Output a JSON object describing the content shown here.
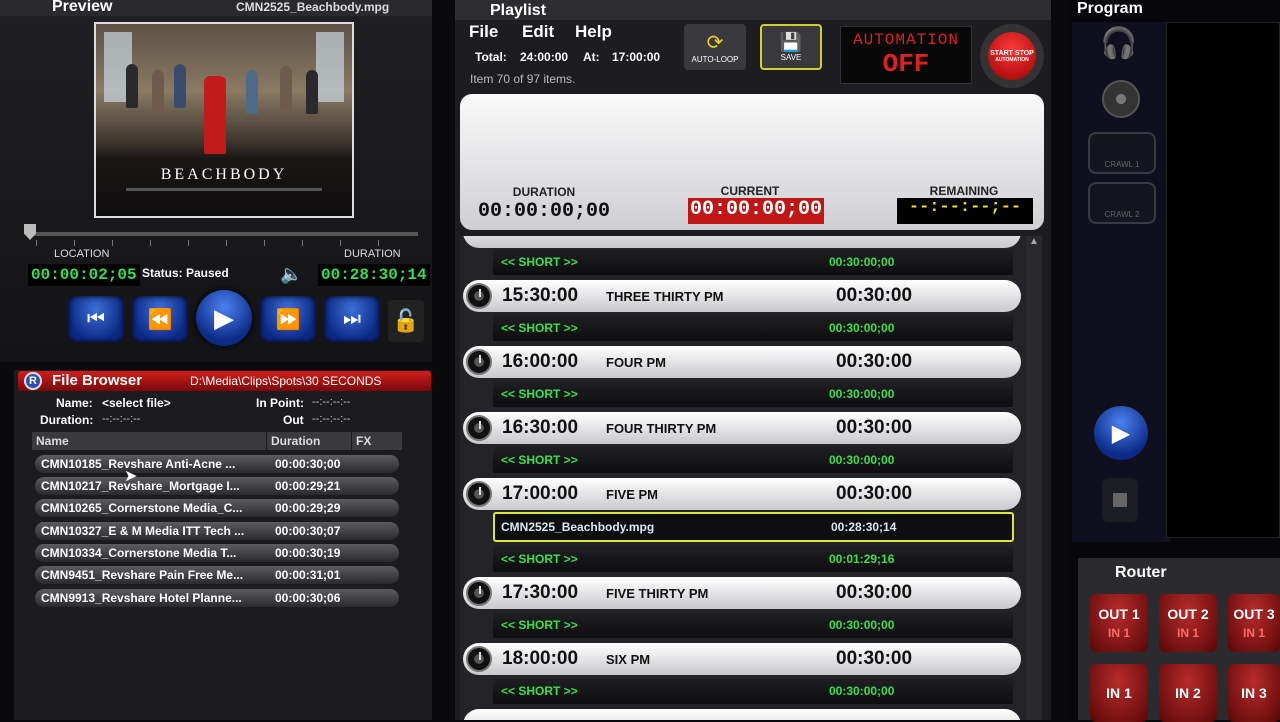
{
  "preview": {
    "title": "Preview",
    "file": "CMN2525_Beachbody.mpg",
    "video_brand": "BEACHBODY",
    "location_label": "LOCATION",
    "duration_label": "DURATION",
    "location": "00:00:02;05",
    "status": "Status: Paused",
    "duration": "00:28:30;14"
  },
  "file_browser": {
    "title": "File Browser",
    "path": "D:\\Media\\Clips\\Spots\\30 SECONDS",
    "name_label": "Name:",
    "name_value": "<select file>",
    "duration_label": "Duration:",
    "duration_value": "--:--:--:--",
    "in_label": "In Point:",
    "in_value": "--:--:--:--",
    "out_label": "Out",
    "out_value": "--:--:--:--",
    "columns": [
      "Name",
      "Duration",
      "FX"
    ],
    "files": [
      {
        "name": "CMN10185_Revshare Anti-Acne ...",
        "duration": "00:00:30;00"
      },
      {
        "name": "CMN10217_Revshare_Mortgage I...",
        "duration": "00:00:29;21"
      },
      {
        "name": "CMN10265_Cornerstone Media_C...",
        "duration": "00:00:29;29"
      },
      {
        "name": "CMN10327_E & M Media ITT Tech ...",
        "duration": "00:00:30;07"
      },
      {
        "name": "CMN10334_Cornerstone Media T...",
        "duration": "00:00:30;19"
      },
      {
        "name": "CMN9451_Revshare Pain Free Me...",
        "duration": "00:00:31;01"
      },
      {
        "name": "CMN9913_Revshare Hotel Planne...",
        "duration": "00:00:30;06"
      }
    ]
  },
  "playlist": {
    "title": "Playlist",
    "menu": [
      "File",
      "Edit",
      "Help"
    ],
    "total_label": "Total:",
    "total": "24:00:00",
    "at_label": "At:",
    "at": "17:00:00",
    "item_info": "Item 70 of 97 items.",
    "autoloop": "AUTO-LOOP",
    "save": "SAVE",
    "automation_label": "AUTOMATION",
    "automation_state": "OFF",
    "start_stop": "START STOP",
    "automation_small": "AUTOMATION",
    "duration_label": "DURATION",
    "duration": "00:00:00;00",
    "current_label": "CURRENT",
    "current": "00:00:00;00",
    "remaining_label": "REMAINING",
    "remaining": "--:--:--;--",
    "short_label": "<< SHORT >>",
    "blocks": [
      {
        "time": "15:30:00",
        "name": "THREE THIRTY PM",
        "dur": "00:30:00",
        "short": "00:30:00;00"
      },
      {
        "time": "16:00:00",
        "name": "FOUR PM",
        "dur": "00:30:00",
        "short": "00:30:00;00"
      },
      {
        "time": "16:30:00",
        "name": "FOUR THIRTY PM",
        "dur": "00:30:00",
        "short": "00:30:00;00"
      },
      {
        "time": "17:00:00",
        "name": "FIVE PM",
        "dur": "00:30:00",
        "clip": "CMN2525_Beachbody.mpg",
        "clip_dur": "00:28:30;14",
        "short": "00:01:29;16"
      },
      {
        "time": "17:30:00",
        "name": "FIVE THIRTY PM",
        "dur": "00:30:00",
        "short": "00:30:00;00"
      },
      {
        "time": "18:00:00",
        "name": "SIX PM",
        "dur": "00:30:00",
        "short": "00:30:00;00"
      }
    ],
    "first_short": "00:30:00;00"
  },
  "program": {
    "title": "Program",
    "crawl": "CRAWL 1",
    "crawl2": "CRAWL 2"
  },
  "router": {
    "title": "Router",
    "outs": [
      "OUT 1",
      "OUT 2",
      "OUT 3"
    ],
    "out_ins": [
      "IN 1",
      "IN 1",
      "IN 1"
    ],
    "ins": [
      "IN 1",
      "IN 2",
      "IN 3"
    ]
  },
  "colors": {
    "accent_green": "#32e052",
    "accent_red": "#d21d1d",
    "blue": "#0c2a86"
  }
}
